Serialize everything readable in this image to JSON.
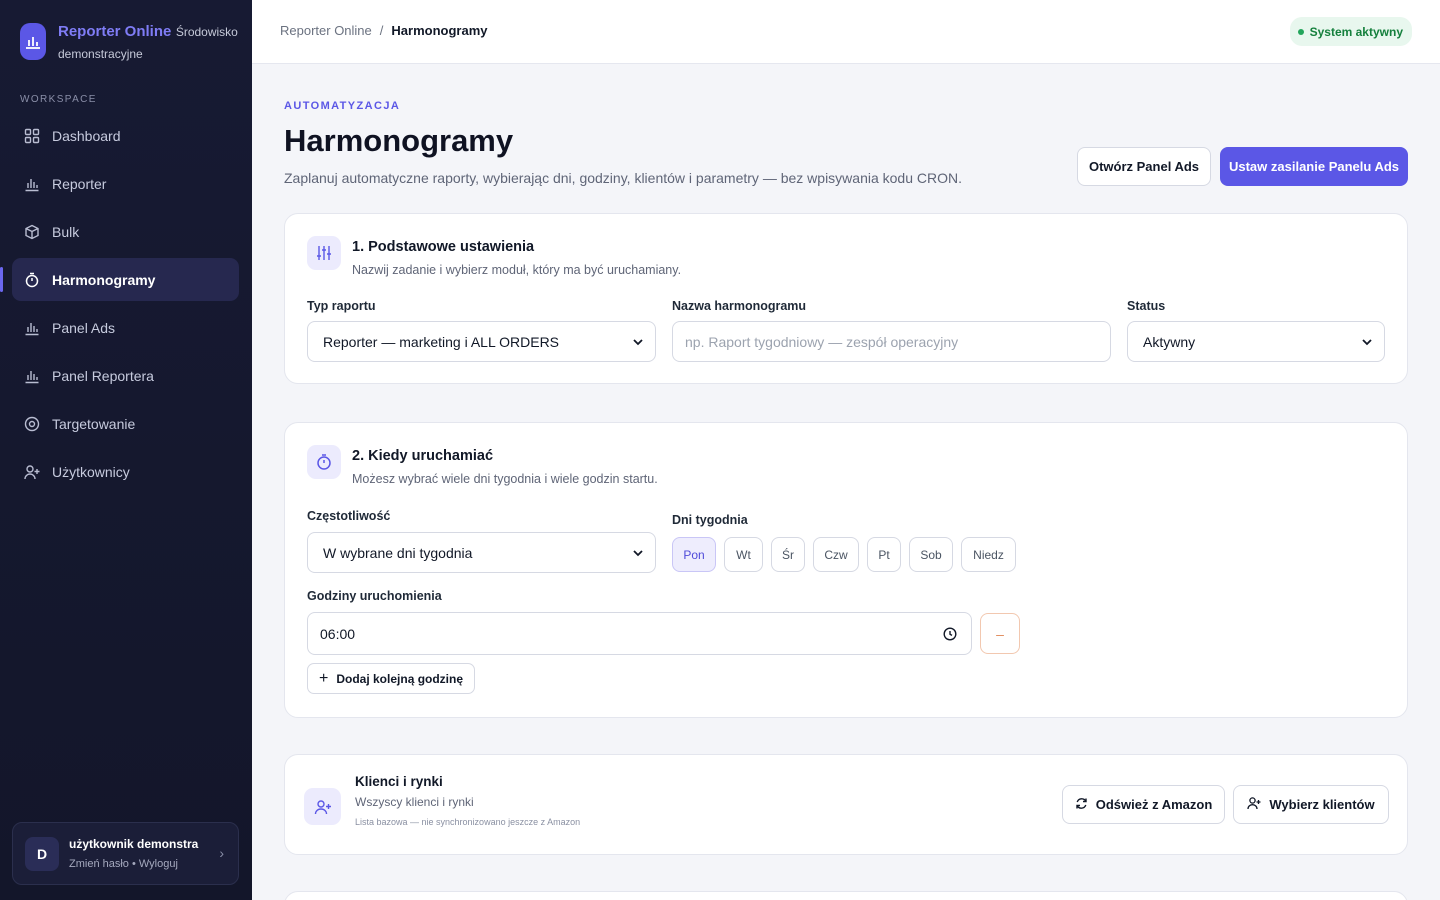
{
  "brand": {
    "name": "Reporter Online",
    "env": "Środowisko demonstracyjne"
  },
  "sidebar": {
    "section_label": "WORKSPACE",
    "items": [
      {
        "label": "Dashboard",
        "icon": "grid-icon"
      },
      {
        "label": "Reporter",
        "icon": "bar-chart-icon"
      },
      {
        "label": "Bulk",
        "icon": "box-icon"
      },
      {
        "label": "Harmonogramy",
        "icon": "timer-icon",
        "active": true
      },
      {
        "label": "Panel Ads",
        "icon": "bar-chart-icon"
      },
      {
        "label": "Panel Reportera",
        "icon": "bar-chart-icon"
      },
      {
        "label": "Targetowanie",
        "icon": "target-icon"
      },
      {
        "label": "Użytkownicy",
        "icon": "user-plus-icon"
      }
    ],
    "user": {
      "initial": "D",
      "name": "użytkownik demonstra...",
      "links": "Zmień hasło • Wyloguj"
    }
  },
  "header": {
    "breadcrumb_root": "Reporter Online",
    "breadcrumb_sep": "/",
    "breadcrumb_current": "Harmonogramy",
    "status": "System aktywny"
  },
  "page": {
    "eyebrow": "AUTOMATYZACJA",
    "title": "Harmonogramy",
    "subtitle": "Zaplanuj automatyczne raporty, wybierając dni, godziny, klientów i parametry — bez wpisywania kodu CRON.",
    "btn_open_panel": "Otwórz Panel Ads",
    "btn_set_feed": "Ustaw zasilanie Panelu Ads"
  },
  "basic": {
    "title": "1. Podstawowe ustawienia",
    "subtitle": "Nazwij zadanie i wybierz moduł, który ma być uruchamiany.",
    "report_type_label": "Typ raportu",
    "report_type_value": "Reporter — marketing i ALL ORDERS",
    "name_label": "Nazwa harmonogramu",
    "name_placeholder": "np. Raport tygodniowy — zespół operacyjny",
    "status_label": "Status",
    "status_value": "Aktywny"
  },
  "schedule": {
    "title": "2. Kiedy uruchamiać",
    "subtitle": "Możesz wybrać wiele dni tygodnia i wiele godzin startu.",
    "frequency_label": "Częstotliwość",
    "frequency_value": "W wybrane dni tygodnia",
    "days_label": "Dni tygodnia",
    "days": [
      "Pon",
      "Wt",
      "Śr",
      "Czw",
      "Pt",
      "Sob",
      "Niedz"
    ],
    "selected_day": "Pon",
    "hours_label": "Godziny uruchomienia",
    "hour_value": "06:00",
    "remove_symbol": "–",
    "add_hour": "Dodaj kolejną godzinę"
  },
  "clients": {
    "title": "Klienci i rynki",
    "subtitle": "Wszyscy klienci i rynki",
    "note": "Lista bazowa — nie synchronizowano jeszcze z Amazon",
    "refresh": "Odśwież z Amazon",
    "choose": "Wybierz klientów"
  },
  "colors": {
    "accent": "#5b57e6",
    "sidebar": "#171a33",
    "status_green": "#15803d"
  }
}
